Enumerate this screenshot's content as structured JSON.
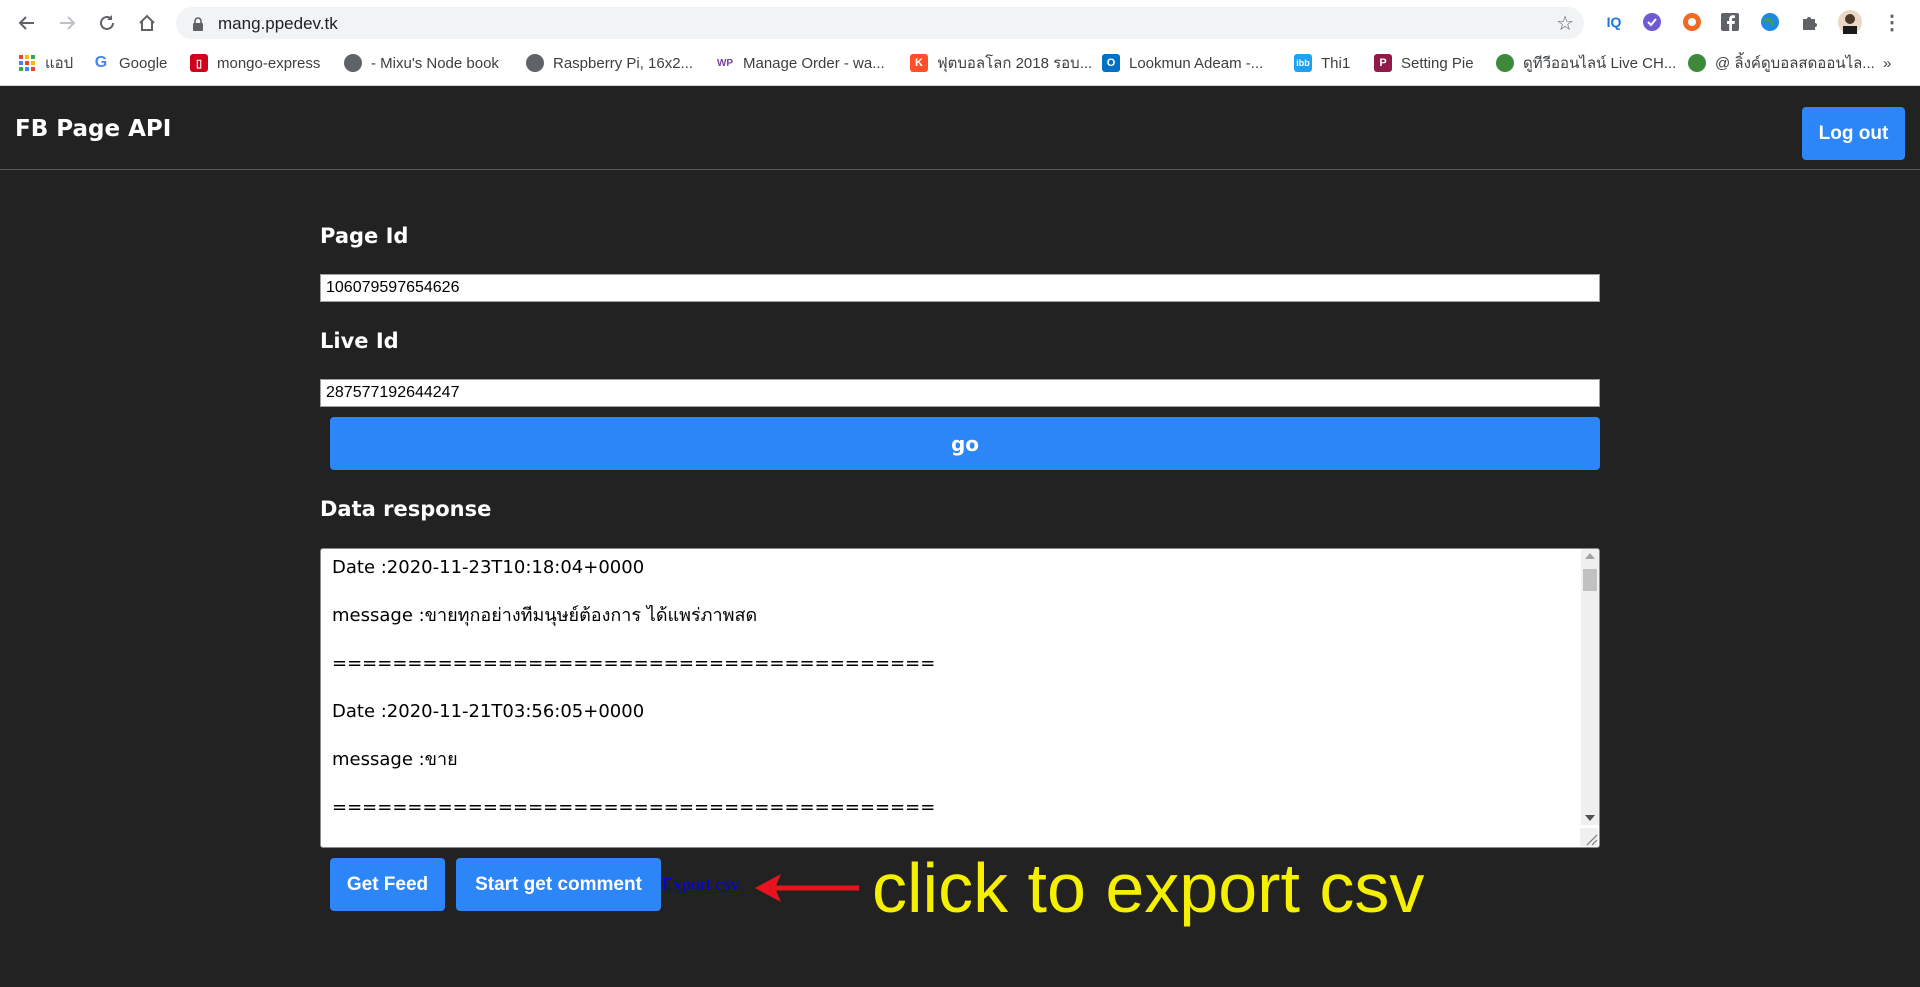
{
  "browser": {
    "url": "mang.ppedev.tk",
    "bookmarks": [
      {
        "label": "แอป",
        "icon": "apps-grid-icon"
      },
      {
        "label": "Google",
        "icon": "google-icon"
      },
      {
        "label": "mongo-express",
        "icon": "mongo-express-icon"
      },
      {
        "label": "- Mixu's Node book",
        "icon": "globe-icon"
      },
      {
        "label": "Raspberry Pi, 16x2...",
        "icon": "globe-icon"
      },
      {
        "label": "Manage Order - wa...",
        "icon": "wp-icon"
      },
      {
        "label": "ฟุตบอลโลก 2018 รอบ...",
        "icon": "k-icon"
      },
      {
        "label": "Lookmun Adeam -...",
        "icon": "outlook-icon"
      },
      {
        "label": "Thi1",
        "icon": "ibb-icon"
      },
      {
        "label": "Setting Pie",
        "icon": "p-icon"
      },
      {
        "label": "ดูทีวีออนไลน์ Live CH...",
        "icon": "tv-icon"
      },
      {
        "label": "@ ลิ้งค์ดูบอลสดออนไล...",
        "icon": "tv-icon"
      }
    ],
    "more": "»",
    "extensions": [
      "IQ"
    ]
  },
  "app": {
    "title": "FB Page API",
    "logout_label": "Log out"
  },
  "form": {
    "page_id_label": "Page Id",
    "page_id_value": "106079597654626",
    "live_id_label": "Live Id",
    "live_id_value": "287577192644247",
    "go_label": "go",
    "response_label": "Data response",
    "response_lines": [
      "Date :2020-11-23T10:18:04+0000",
      "message :ขายทุกอย่างที่มนุษย์ต้องการ ได้แพร่ภาพสด",
      "========================================",
      "Date :2020-11-21T03:56:05+0000",
      "message :ขาย",
      "========================================"
    ],
    "get_feed_label": "Get Feed",
    "start_comment_label": "Start get comment",
    "export_label": "Export csv"
  },
  "annotation": {
    "text": "click to export csv",
    "color": "#f5ef00",
    "arrow_color": "#e8141c"
  },
  "colors": {
    "accent": "#2d86f8",
    "background": "#222222"
  }
}
